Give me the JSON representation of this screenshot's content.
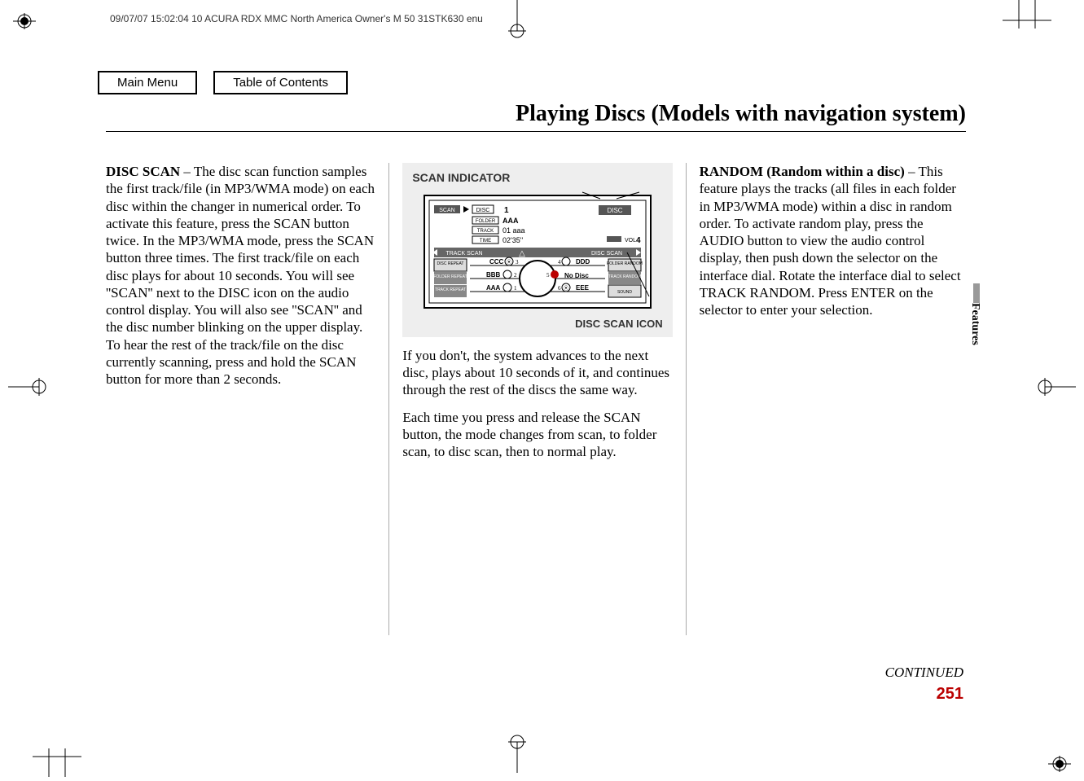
{
  "print_header": "09/07/07 15:02:04    10 ACURA RDX MMC North America Owner's M 50 31STK630 enu",
  "nav": {
    "main_menu": "Main Menu",
    "toc": "Table of Contents"
  },
  "title": "Playing Discs (Models with navigation system)",
  "col1": {
    "h1": "DISC SCAN",
    "sep": " – ",
    "body": "The disc scan function samples the first track/file (in MP3/WMA mode) on each disc within the changer in numerical order. To activate this feature, press the SCAN button twice. In the MP3/WMA mode, press the SCAN button three times. The first track/file on each disc plays for about 10 seconds. You will see ''SCAN'' next to the DISC icon on the audio control display. You will also see ''SCAN'' and the disc number blinking on the upper display. To hear the rest of the track/file on the disc currently scanning, press and hold the SCAN button for more than 2 seconds."
  },
  "col2": {
    "figure_title": "SCAN INDICATOR",
    "figure_caption": "DISC SCAN ICON",
    "display": {
      "scan": "SCAN",
      "disc_badge": "DISC",
      "folder": "FOLDER",
      "folder_val": "AAA",
      "track": "TRACK",
      "track_val": "01 aaa",
      "time": "TIME",
      "time_val": "02'35''",
      "vol": "VOL",
      "vol_val": "4",
      "track_scan": "TRACK SCAN",
      "disc_scan": "DISC SCAN",
      "disc_repeat": "DISC REPEAT",
      "folder_repeat": "FOLDER REPEAT",
      "track_repeat": "TRACK REPEAT",
      "folder_random": "FOLDER RANDOM",
      "track_random": "TRACK RANDOM",
      "sound": "SOUND",
      "slots": {
        "s1": "AAA",
        "s2": "BBB",
        "s3": "CCC",
        "s4": "DDD",
        "s5": "No Disc",
        "s6": "EEE"
      },
      "disc_num": "1",
      "disc_tag": "DISC"
    },
    "p1": "If you don't, the system advances to the next disc, plays about 10 seconds of it, and continues through the rest of the discs the same way.",
    "p2": "Each time you press and release the SCAN button, the mode changes from scan, to folder scan, to disc scan, then to normal play."
  },
  "col3": {
    "h1": "RANDOM (Random within a disc)",
    "sep": " – ",
    "body": "This feature plays the tracks (all files in each folder in MP3/WMA mode) within a disc in random order. To activate random play, press the AUDIO button to view the audio control display, then push down the selector on the interface dial. Rotate the interface dial to select TRACK RANDOM. Press ENTER on the selector to enter your selection."
  },
  "side_label": "Features",
  "continued": "CONTINUED",
  "page_number": "251"
}
